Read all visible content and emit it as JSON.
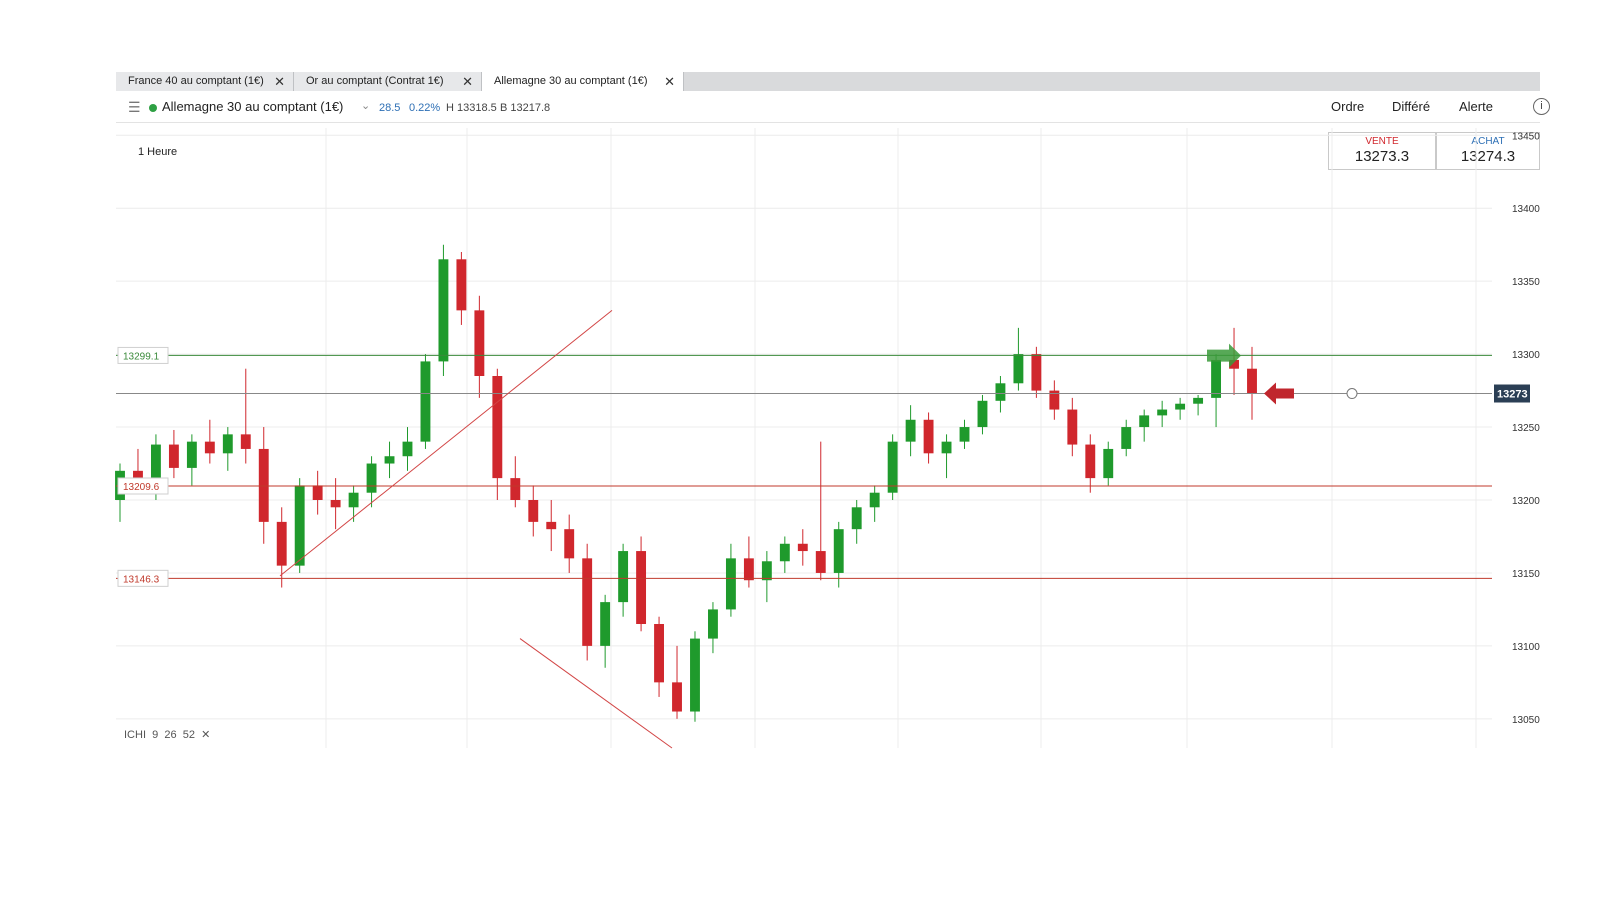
{
  "tabs": [
    {
      "label": "France 40 au comptant (1€)",
      "close": "✕"
    },
    {
      "label": "Or au comptant (Contrat 1€)",
      "close": "✕"
    },
    {
      "label": "Allemagne 30 au comptant (1€)",
      "close": "✕",
      "active": true
    }
  ],
  "header": {
    "menu_icon": "☰",
    "instrument": "Allemagne 30 au comptant (1€)",
    "chevron": "⌄",
    "change": "28.5",
    "change_pct": "0.22%",
    "high": "H 13318.5",
    "low": "B 13217.8",
    "ordre": "Ordre",
    "differe": "Différé",
    "alerte": "Alerte",
    "info": "i",
    "status_color": "#2ea043"
  },
  "timeframe": "1 Heure",
  "quotes": {
    "sell_label": "VENTE",
    "sell_value": "13273.3",
    "buy_label": "ACHAT",
    "buy_value": "13274.3",
    "sell_color": "#d0272d",
    "buy_color": "#2d6fb5"
  },
  "indicator": {
    "name": "ICHI",
    "p1": "9",
    "p2": "26",
    "p3": "52",
    "close": "✕"
  },
  "chart_data": {
    "type": "candlestick",
    "ylim": [
      13030,
      13455
    ],
    "y_ticks": [
      "13450",
      "13400",
      "13350",
      "13300",
      "13250",
      "13200",
      "13150",
      "13100",
      "13050"
    ],
    "current_price_label": "13273",
    "levels": [
      {
        "value": 13299.1,
        "label": "13299.1",
        "color": "#3a8a3a"
      },
      {
        "value": 13209.6,
        "label": "13209.6",
        "color": "#c0392b"
      },
      {
        "value": 13146.3,
        "label": "13146.3",
        "color": "#c0392b"
      }
    ],
    "candles": [
      [
        13200,
        13225,
        13185,
        13220
      ],
      [
        13220,
        13235,
        13205,
        13210
      ],
      [
        13210,
        13245,
        13200,
        13238
      ],
      [
        13238,
        13248,
        13215,
        13222
      ],
      [
        13222,
        13245,
        13210,
        13240
      ],
      [
        13240,
        13255,
        13225,
        13232
      ],
      [
        13232,
        13250,
        13220,
        13245
      ],
      [
        13245,
        13290,
        13225,
        13235
      ],
      [
        13235,
        13250,
        13170,
        13185
      ],
      [
        13185,
        13195,
        13140,
        13155
      ],
      [
        13155,
        13215,
        13150,
        13210
      ],
      [
        13210,
        13220,
        13190,
        13200
      ],
      [
        13200,
        13215,
        13180,
        13195
      ],
      [
        13195,
        13210,
        13185,
        13205
      ],
      [
        13205,
        13230,
        13195,
        13225
      ],
      [
        13225,
        13240,
        13215,
        13230
      ],
      [
        13230,
        13250,
        13220,
        13240
      ],
      [
        13240,
        13300,
        13235,
        13295
      ],
      [
        13295,
        13375,
        13285,
        13365
      ],
      [
        13365,
        13370,
        13320,
        13330
      ],
      [
        13330,
        13340,
        13270,
        13285
      ],
      [
        13285,
        13290,
        13200,
        13215
      ],
      [
        13215,
        13230,
        13195,
        13200
      ],
      [
        13200,
        13210,
        13175,
        13185
      ],
      [
        13185,
        13200,
        13165,
        13180
      ],
      [
        13180,
        13190,
        13150,
        13160
      ],
      [
        13160,
        13170,
        13090,
        13100
      ],
      [
        13100,
        13135,
        13085,
        13130
      ],
      [
        13130,
        13170,
        13120,
        13165
      ],
      [
        13165,
        13175,
        13110,
        13115
      ],
      [
        13115,
        13120,
        13065,
        13075
      ],
      [
        13075,
        13100,
        13050,
        13055
      ],
      [
        13055,
        13110,
        13048,
        13105
      ],
      [
        13105,
        13130,
        13095,
        13125
      ],
      [
        13125,
        13170,
        13120,
        13160
      ],
      [
        13160,
        13175,
        13140,
        13145
      ],
      [
        13145,
        13165,
        13130,
        13158
      ],
      [
        13158,
        13175,
        13150,
        13170
      ],
      [
        13170,
        13180,
        13155,
        13165
      ],
      [
        13165,
        13240,
        13145,
        13150
      ],
      [
        13150,
        13185,
        13140,
        13180
      ],
      [
        13180,
        13200,
        13170,
        13195
      ],
      [
        13195,
        13210,
        13185,
        13205
      ],
      [
        13205,
        13245,
        13200,
        13240
      ],
      [
        13240,
        13265,
        13230,
        13255
      ],
      [
        13255,
        13260,
        13225,
        13232
      ],
      [
        13232,
        13245,
        13215,
        13240
      ],
      [
        13240,
        13255,
        13235,
        13250
      ],
      [
        13250,
        13272,
        13245,
        13268
      ],
      [
        13268,
        13285,
        13260,
        13280
      ],
      [
        13280,
        13318,
        13275,
        13300
      ],
      [
        13300,
        13305,
        13270,
        13275
      ],
      [
        13275,
        13282,
        13255,
        13262
      ],
      [
        13262,
        13270,
        13230,
        13238
      ],
      [
        13238,
        13245,
        13205,
        13215
      ],
      [
        13215,
        13240,
        13210,
        13235
      ],
      [
        13235,
        13255,
        13230,
        13250
      ],
      [
        13250,
        13262,
        13240,
        13258
      ],
      [
        13258,
        13268,
        13250,
        13262
      ],
      [
        13262,
        13270,
        13255,
        13266
      ],
      [
        13266,
        13272,
        13258,
        13270
      ],
      [
        13270,
        13300,
        13250,
        13296
      ],
      [
        13296,
        13318,
        13272,
        13290
      ],
      [
        13290,
        13305,
        13255,
        13273
      ]
    ]
  }
}
